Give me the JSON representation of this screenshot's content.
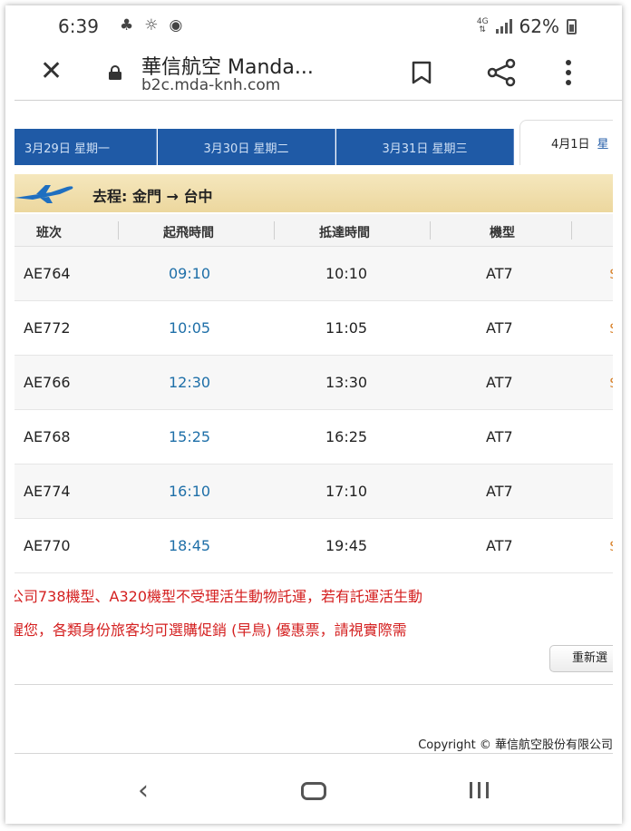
{
  "status_bar": {
    "time": "6:39",
    "network": "4G",
    "battery": "62%"
  },
  "browser": {
    "page_title": "華信航空 Manda...",
    "url": "b2c.mda-knh.com"
  },
  "date_tabs": [
    {
      "date": "3月29日",
      "weekday": "星期一"
    },
    {
      "date": "3月30日",
      "weekday": "星期二"
    },
    {
      "date": "3月31日",
      "weekday": "星期三"
    },
    {
      "date": "4月1日",
      "weekday": "星"
    }
  ],
  "route": {
    "label": "去程: 金門 → 台中"
  },
  "table": {
    "headers": [
      "班次",
      "起飛時間",
      "抵達時間",
      "機型"
    ],
    "rows": [
      {
        "flight": "AE764",
        "departure": "09:10",
        "arrival": "10:10",
        "aircraft": "AT7",
        "price": "$"
      },
      {
        "flight": "AE772",
        "departure": "10:05",
        "arrival": "11:05",
        "aircraft": "AT7",
        "price": "$"
      },
      {
        "flight": "AE766",
        "departure": "12:30",
        "arrival": "13:30",
        "aircraft": "AT7",
        "price": "$"
      },
      {
        "flight": "AE768",
        "departure": "15:25",
        "arrival": "16:25",
        "aircraft": "AT7",
        "price": ""
      },
      {
        "flight": "AE774",
        "departure": "16:10",
        "arrival": "17:10",
        "aircraft": "AT7",
        "price": ""
      },
      {
        "flight": "AE770",
        "departure": "18:45",
        "arrival": "19:45",
        "aircraft": "AT7",
        "price": "$"
      }
    ]
  },
  "notices": [
    "公司738機型、A320機型不受理活生動物託運，若有託運活生動",
    "醒您，各類身份旅客均可選購促銷 (早鳥) 優惠票，請視實際需"
  ],
  "reselect_label": "重新選",
  "copyright": "Copyright © 華信航空股份有限公司",
  "colors": {
    "tab_blue": "#1f5aa6",
    "route_gold": "#ecd79e",
    "departure_blue": "#1e6fa8",
    "notice_red": "#d42020",
    "price_orange": "#d9822b"
  }
}
